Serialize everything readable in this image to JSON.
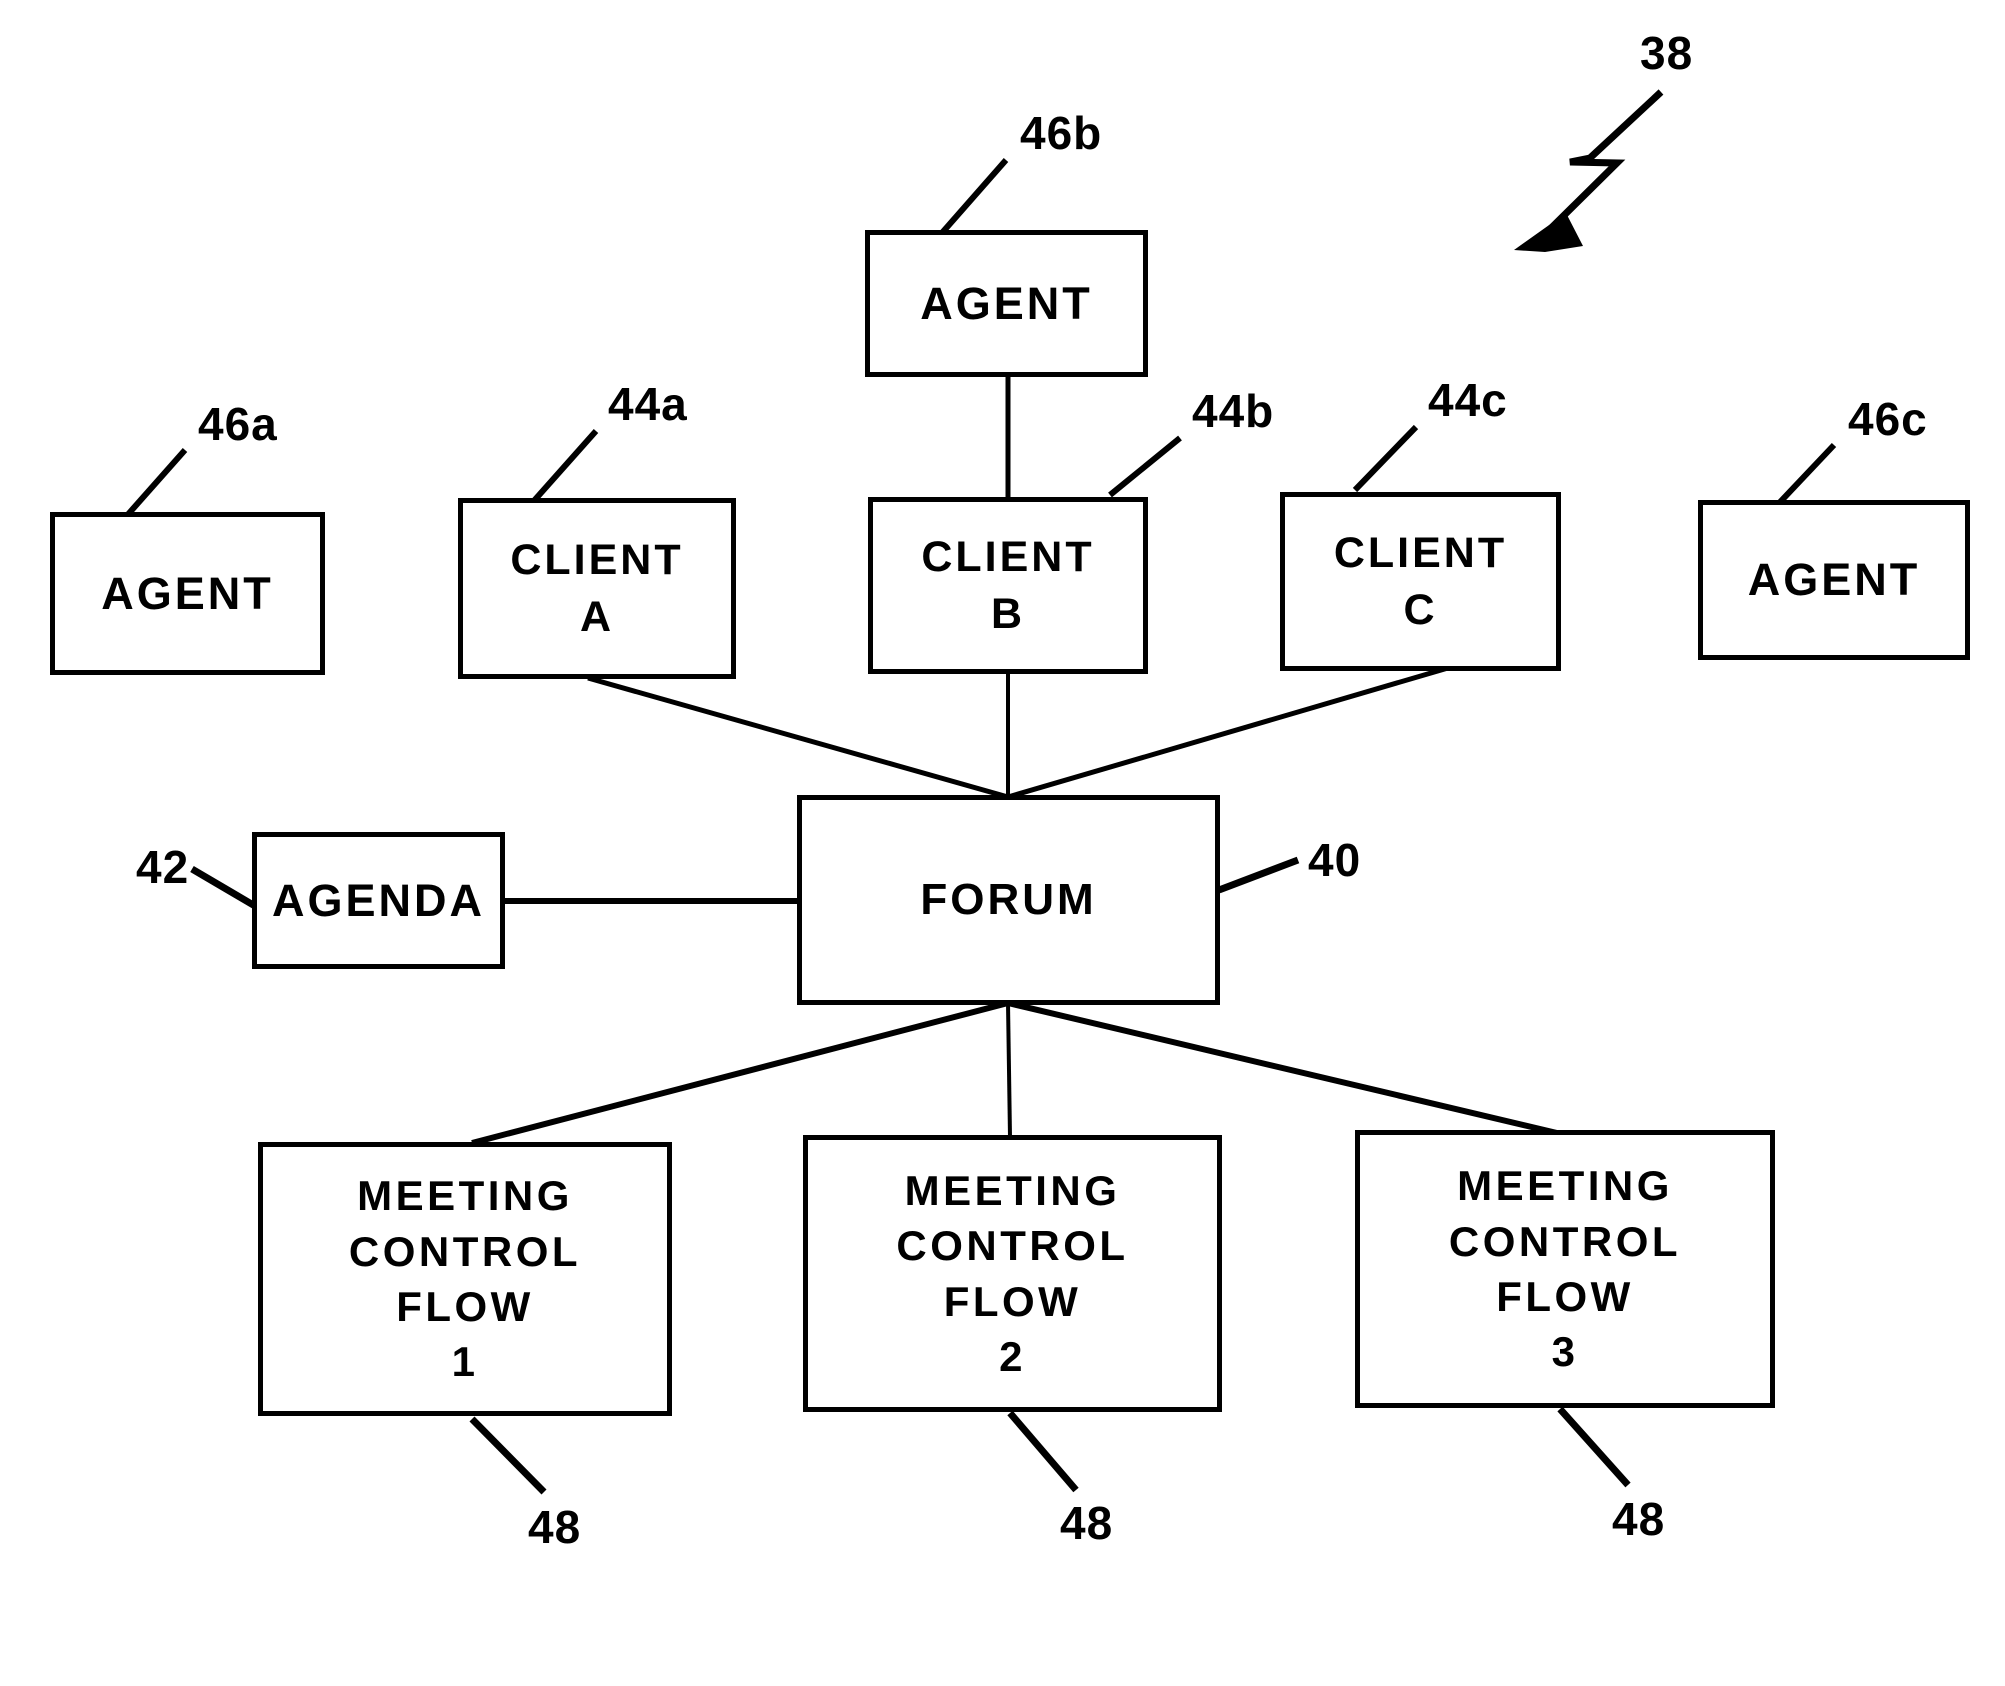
{
  "figure": {
    "figure_number": "38",
    "background_color": "#ffffff",
    "line_color": "#000000"
  },
  "nodes": {
    "agent_left": {
      "id": "46a",
      "label": "AGENT"
    },
    "agent_top": {
      "id": "46b",
      "label": "AGENT"
    },
    "agent_right": {
      "id": "46c",
      "label": "AGENT"
    },
    "client_a": {
      "id": "44a",
      "label_line1": "CLIENT",
      "label_line2": "A"
    },
    "client_b": {
      "id": "44b",
      "label_line1": "CLIENT",
      "label_line2": "B"
    },
    "client_c": {
      "id": "44c",
      "label_line1": "CLIENT",
      "label_line2": "C"
    },
    "agenda": {
      "id": "42",
      "label": "AGENDA"
    },
    "forum": {
      "id": "40",
      "label": "FORUM"
    },
    "mcf1": {
      "id": "48",
      "label_line1": "MEETING",
      "label_line2": "CONTROL",
      "label_line3": "FLOW",
      "label_line4": "1"
    },
    "mcf2": {
      "id": "48",
      "label_line1": "MEETING",
      "label_line2": "CONTROL",
      "label_line3": "FLOW",
      "label_line4": "2"
    },
    "mcf3": {
      "id": "48",
      "label_line1": "MEETING",
      "label_line2": "CONTROL",
      "label_line3": "FLOW",
      "label_line4": "3"
    }
  },
  "reference_numerals": {
    "fig": "38",
    "forum": "40",
    "agenda": "42",
    "client_a": "44a",
    "client_b": "44b",
    "client_c": "44c",
    "agent_left": "46a",
    "agent_top": "46b",
    "agent_right": "46c",
    "mcf1": "48",
    "mcf2": "48",
    "mcf3": "48"
  }
}
